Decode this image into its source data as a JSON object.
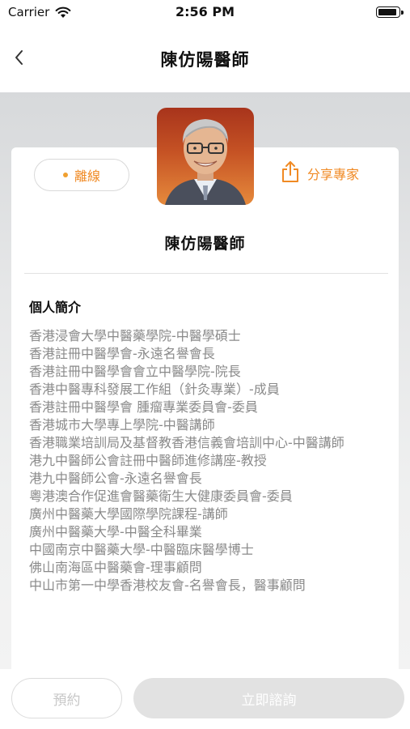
{
  "status_bar": {
    "carrier": "Carrier",
    "time": "2:56 PM",
    "icons": [
      "wifi-icon",
      "battery-icon"
    ]
  },
  "nav": {
    "title": "陳仿陽醫師",
    "back_icon": "chevron-left-icon"
  },
  "profile": {
    "status_label": "離線",
    "status_color": "#f08a24",
    "share_label": "分享專家",
    "share_icon": "share-icon",
    "name": "陳仿陽醫師"
  },
  "bio": {
    "title": "個人簡介",
    "items": [
      "香港浸會大學中醫藥學院-中醫學碩士",
      "香港註冊中醫學會-永遠名譽會長",
      "香港註冊中醫學會會立中醫學院-院長",
      "香港中醫專科發展工作組（針灸專業）-成員",
      "香港註冊中醫學會 腫瘤專業委員會-委員",
      "香港城市大學專上學院-中醫講師",
      "香港職業培訓局及基督教香港信義會培訓中心-中醫講師",
      "港九中醫師公會註冊中醫師進修講座-教授",
      "港九中醫師公會-永遠名譽會長",
      "粵港澳合作促進會醫藥衛生大健康委員會-委員",
      "廣州中醫藥大學國際學院課程-講師",
      "廣州中醫藥大學-中醫全科畢業",
      "中國南京中醫藥大學-中醫臨床醫學博士",
      "佛山南海區中醫藥會-理事顧問",
      "中山市第一中學香港校友會-名譽會長，醫事顧問"
    ]
  },
  "actions": {
    "book_label": "預約",
    "consult_label": "立即諮詢"
  },
  "colors": {
    "accent": "#f08a24",
    "muted_text": "#8a8a8a",
    "disabled_button": "#e2e2e2"
  }
}
